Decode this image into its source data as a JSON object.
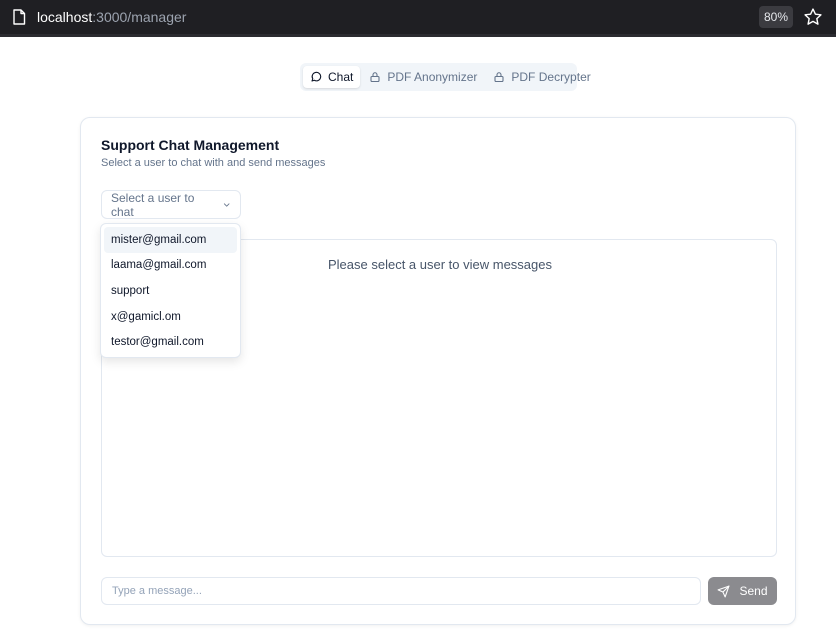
{
  "browser": {
    "url_host": "localhost",
    "url_path": ":3000/manager",
    "zoom": "80%",
    "icons": [
      "page-icon",
      "star-icon"
    ]
  },
  "tabs": [
    {
      "label": "Chat",
      "icon": "message-circle-icon",
      "active": true
    },
    {
      "label": "PDF Anonymizer",
      "icon": "lock-icon",
      "active": false
    },
    {
      "label": "PDF Decrypter",
      "icon": "lock-icon",
      "active": false
    }
  ],
  "card": {
    "title": "Support Chat Management",
    "subtitle": "Select a user to chat with and send messages"
  },
  "user_select": {
    "placeholder": "Select a user to chat",
    "icon": "chevron-down-icon",
    "options": [
      {
        "label": "mister@gmail.com",
        "highlighted": true
      },
      {
        "label": "laama@gmail.com",
        "highlighted": false
      },
      {
        "label": "support",
        "highlighted": false
      },
      {
        "label": "x@gamicl.om",
        "highlighted": false
      },
      {
        "label": "testor@gmail.com",
        "highlighted": false
      }
    ]
  },
  "messages": {
    "empty_text": "Please select a user to view messages"
  },
  "composer": {
    "placeholder": "Type a message...",
    "value": "",
    "send_label": "Send",
    "send_icon": "send-icon",
    "send_color": "#8b8b8f"
  },
  "colors": {
    "browser_bar": "#1f1f23",
    "border": "#e2e8f0",
    "muted_text": "#64748b"
  }
}
